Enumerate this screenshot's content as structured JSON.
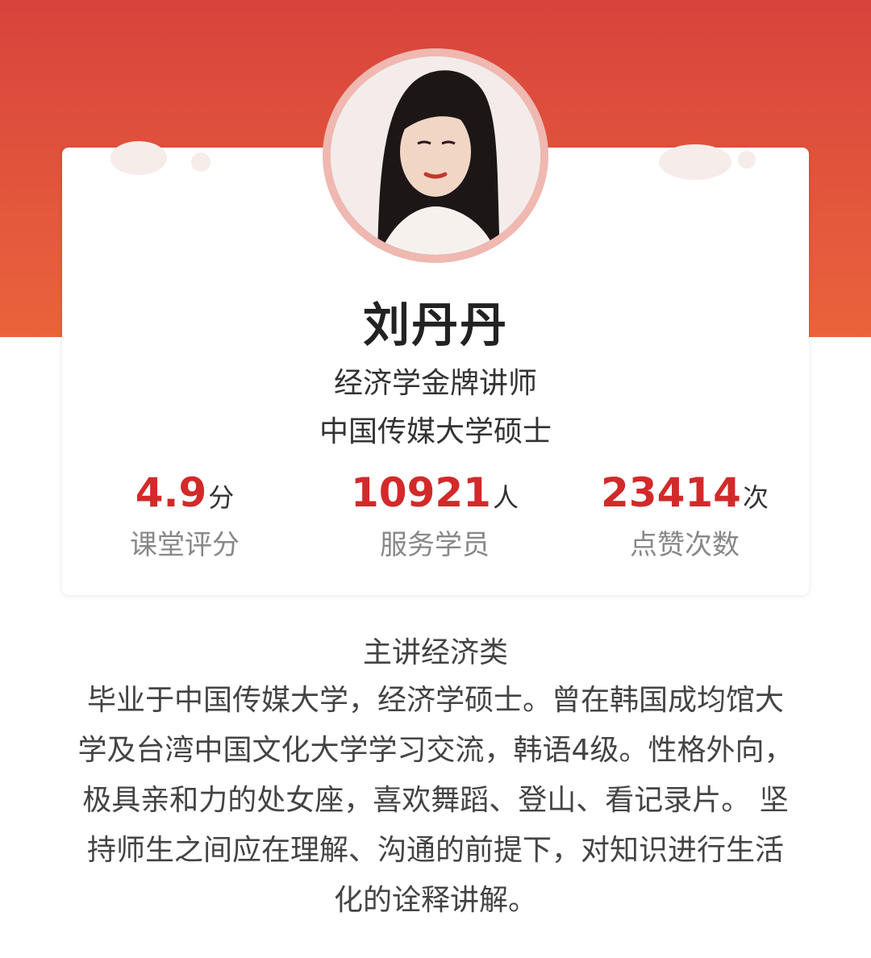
{
  "profile": {
    "name": "刘丹丹",
    "title": "经济学金牌讲师",
    "education": "中国传媒大学硕士"
  },
  "stats": [
    {
      "value": "4.9",
      "unit": "分",
      "label": "课堂评分"
    },
    {
      "value": "10921",
      "unit": "人",
      "label": "服务学员"
    },
    {
      "value": "23414",
      "unit": "次",
      "label": "点赞次数"
    }
  ],
  "intro": {
    "title": "主讲经济类",
    "body": "毕业于中国传媒大学，经济学硕士。曾在韩国成均馆大学及台湾中国文化大学学习交流，韩语4级。性格外向，极具亲和力的处女座，喜欢舞蹈、登山、看记录片。 坚持师生之间应在理解、沟通的前提下，对知识进行生活化的诠释讲解。"
  },
  "colors": {
    "banner": "#e04a3c",
    "accent": "#d22a2a",
    "avatar_ring": "#efb8b0"
  }
}
